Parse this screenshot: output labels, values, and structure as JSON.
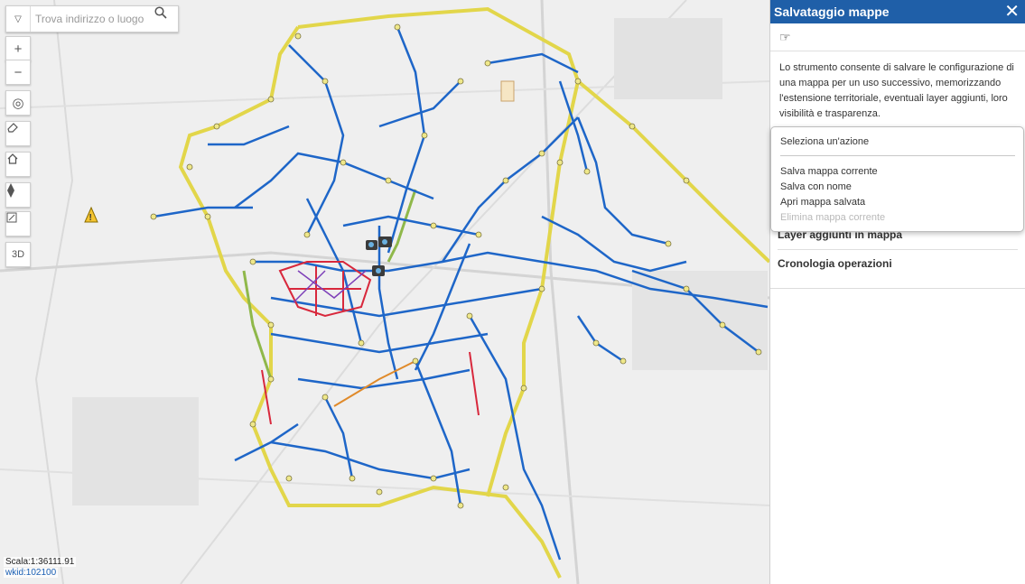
{
  "search": {
    "placeholder": "Trova indirizzo o luogo"
  },
  "map": {
    "scale_text": "Scala:1:36111.91",
    "wkid_text": "wkid:102100",
    "tools": [
      "zoom-in",
      "zoom-out",
      "locate",
      "eraser",
      "home",
      "compass",
      "fullscreen",
      "3d"
    ],
    "tool_3d_label": "3D",
    "colors": {
      "network": "#1e66c8",
      "ring_road": "#e2d64a",
      "historic_center": "#d8283c",
      "highway": "#8fb84a"
    }
  },
  "panel": {
    "title": "Salvataggio mappe",
    "description": "Lo strumento consente di salvare le configurazione di una mappa per un uso successivo, memorizzando l'estensione territoriale, eventuali layer aggiunti, loro visibilità e trasparenza.",
    "sections": [
      "Layer aggiunti in mappa",
      "Cronologia operazioni"
    ],
    "colors": {
      "header": "#1f5fa8"
    }
  },
  "dropdown": {
    "header": "Seleziona un'azione",
    "options": [
      {
        "label": "Salva mappa corrente",
        "enabled": true
      },
      {
        "label": "Salva con nome",
        "enabled": true
      },
      {
        "label": "Apri mappa salvata",
        "enabled": true
      },
      {
        "label": "Elimina mappa corrente",
        "enabled": false
      }
    ]
  }
}
